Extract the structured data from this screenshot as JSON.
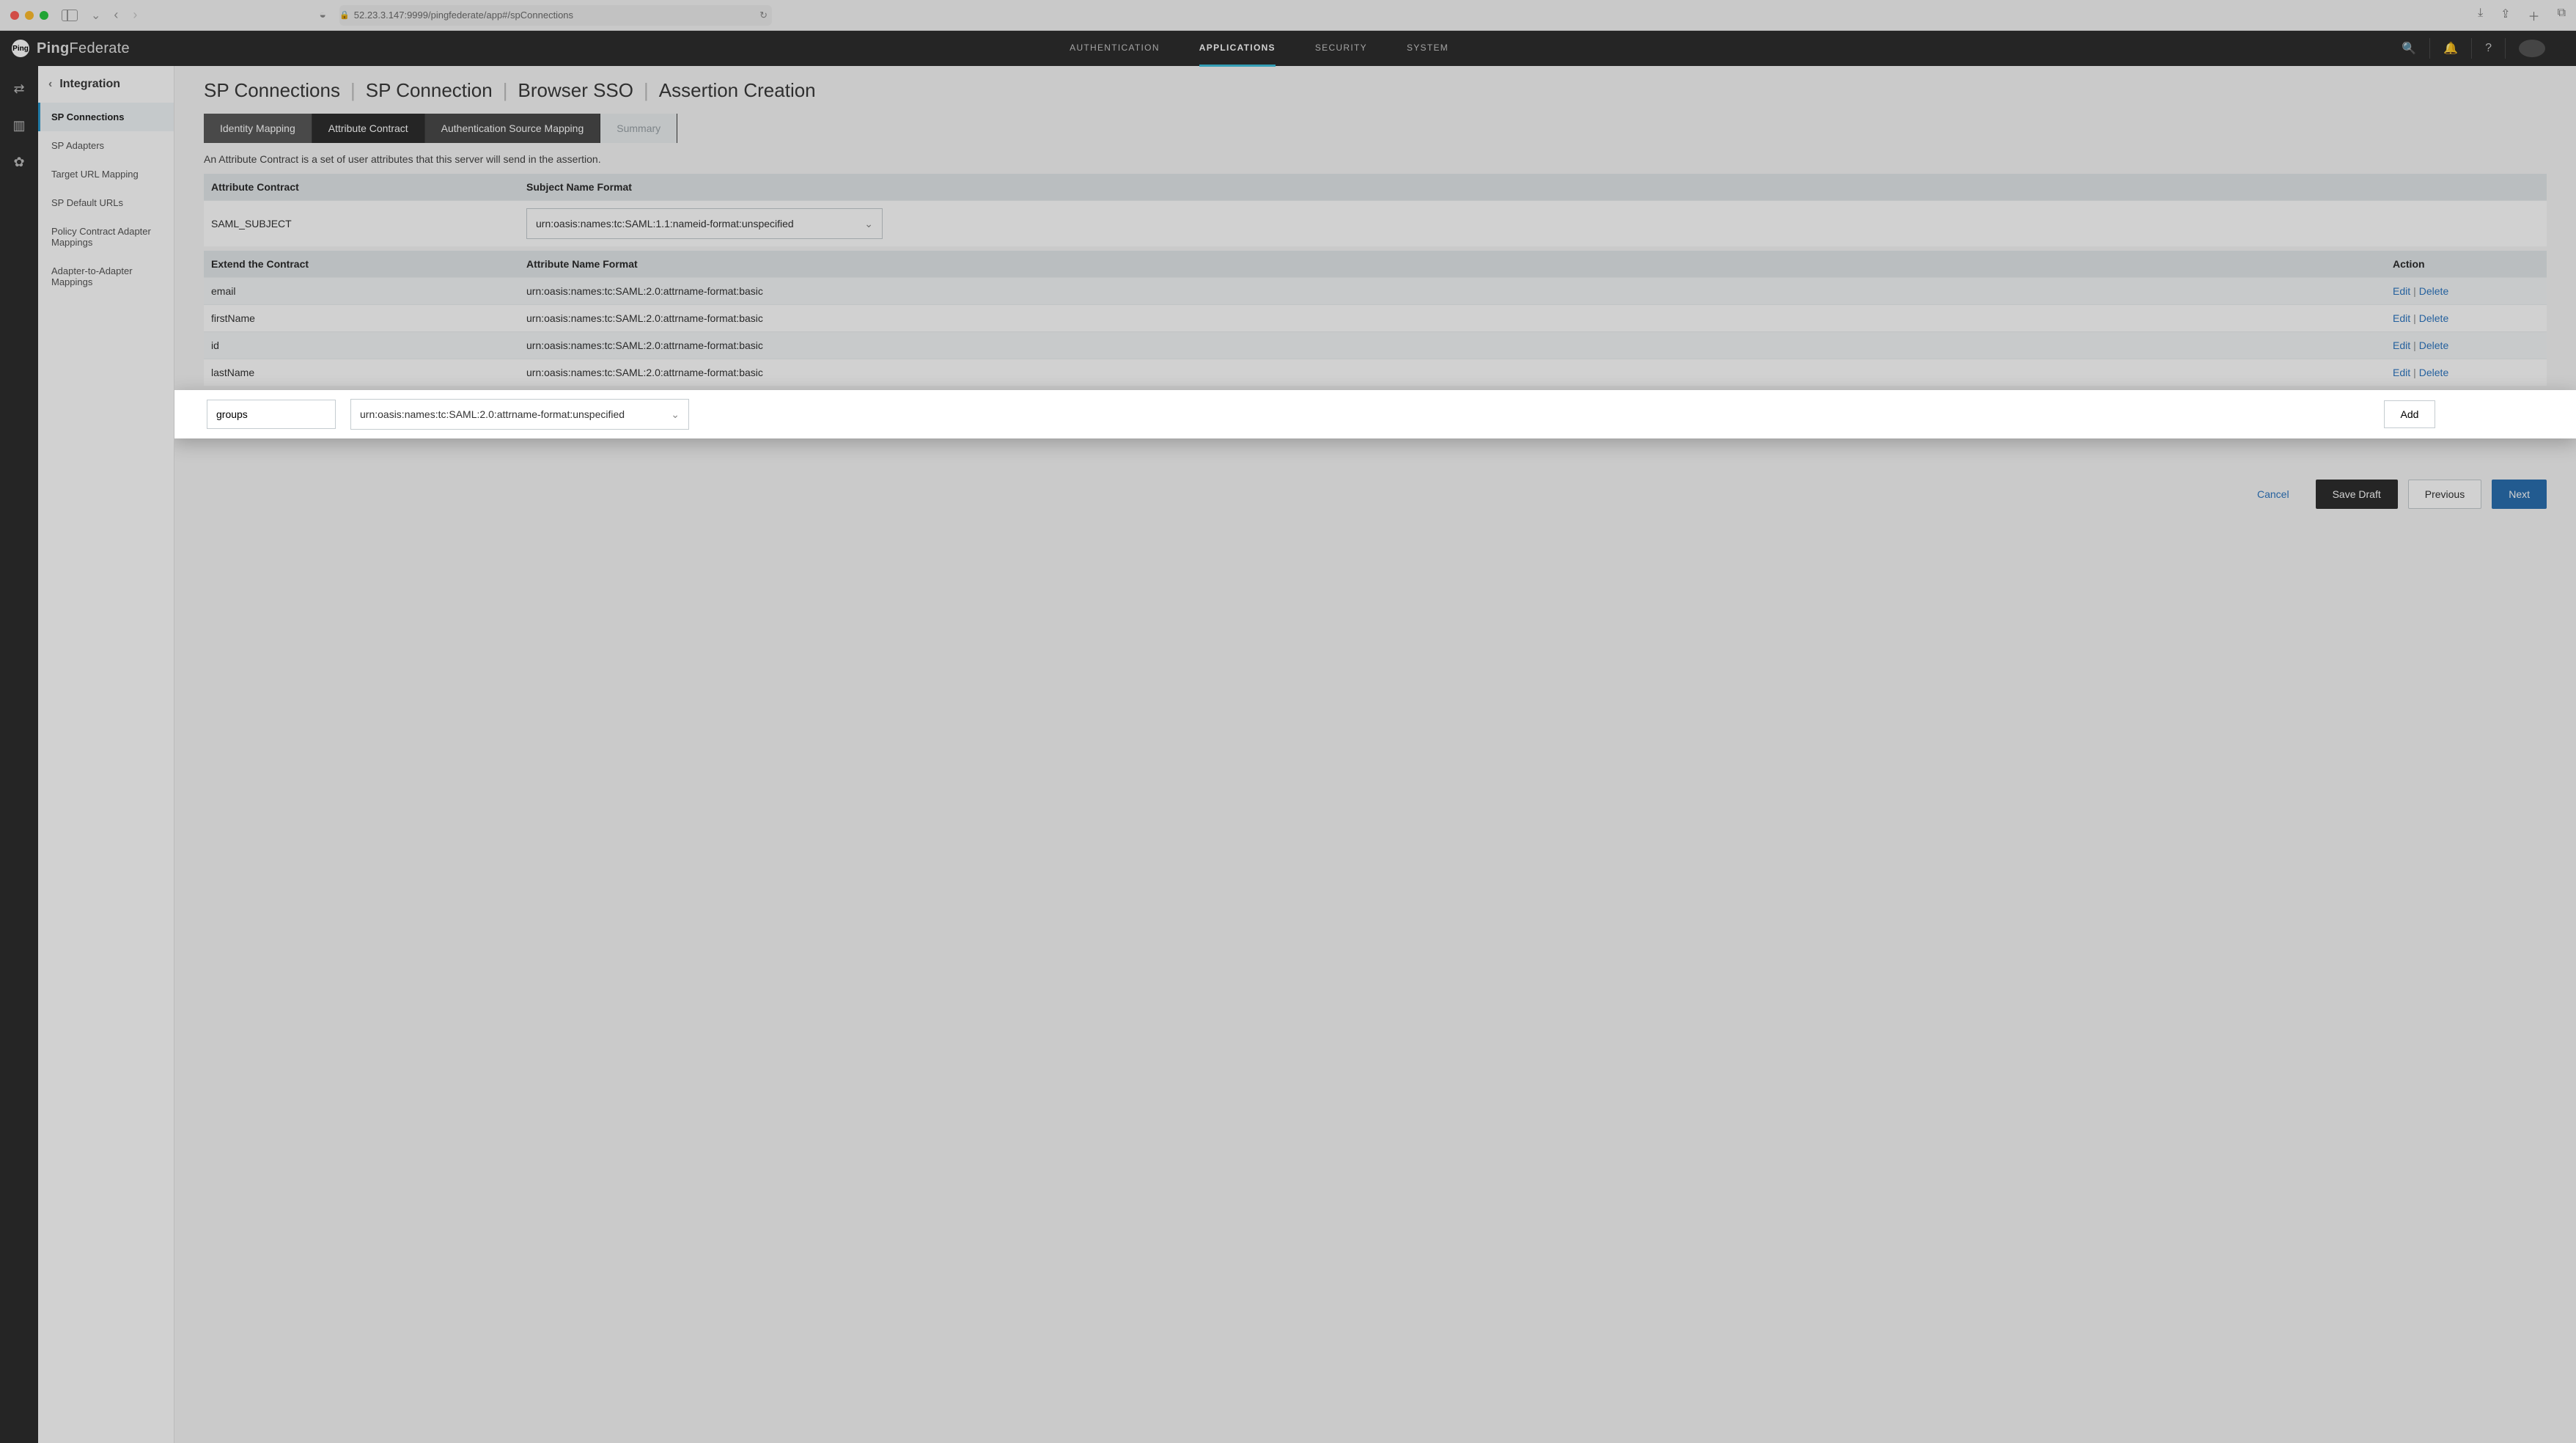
{
  "browser": {
    "url": "52.23.3.147:9999/pingfederate/app#/spConnections"
  },
  "brand": {
    "prefix": "Ping",
    "suffix": "Federate",
    "logo_text": "Ping"
  },
  "top_nav": {
    "items": [
      "AUTHENTICATION",
      "APPLICATIONS",
      "SECURITY",
      "SYSTEM"
    ],
    "active_index": 1
  },
  "sidebar": {
    "header": "Integration",
    "items": [
      {
        "label": "SP Connections",
        "active": true
      },
      {
        "label": "SP Adapters"
      },
      {
        "label": "Target URL Mapping"
      },
      {
        "label": "SP Default URLs"
      },
      {
        "label": "Policy Contract Adapter Mappings"
      },
      {
        "label": "Adapter-to-Adapter Mappings"
      }
    ]
  },
  "breadcrumbs": [
    "SP Connections",
    "SP Connection",
    "Browser SSO",
    "Assertion Creation"
  ],
  "tabs": [
    {
      "label": "Identity Mapping",
      "kind": "prev"
    },
    {
      "label": "Attribute Contract",
      "kind": "active"
    },
    {
      "label": "Authentication Source Mapping",
      "kind": "next"
    },
    {
      "label": "Summary",
      "kind": "disabled"
    }
  ],
  "help_text": "An Attribute Contract is a set of user attributes that this server will send in the assertion.",
  "contract_table": {
    "headers": {
      "attr": "Attribute Contract",
      "fmt": "Subject Name Format"
    },
    "rows": [
      {
        "attr": "SAML_SUBJECT",
        "fmt": "urn:oasis:names:tc:SAML:1.1:nameid-format:unspecified"
      }
    ]
  },
  "extend_table": {
    "headers": {
      "attr": "Extend the Contract",
      "fmt": "Attribute Name Format",
      "act": "Action"
    },
    "rows": [
      {
        "attr": "email",
        "fmt": "urn:oasis:names:tc:SAML:2.0:attrname-format:basic"
      },
      {
        "attr": "firstName",
        "fmt": "urn:oasis:names:tc:SAML:2.0:attrname-format:basic"
      },
      {
        "attr": "id",
        "fmt": "urn:oasis:names:tc:SAML:2.0:attrname-format:basic"
      },
      {
        "attr": "lastName",
        "fmt": "urn:oasis:names:tc:SAML:2.0:attrname-format:basic"
      }
    ],
    "action_edit": "Edit",
    "action_delete": "Delete"
  },
  "add_row": {
    "input_value": "groups",
    "format_value": "urn:oasis:names:tc:SAML:2.0:attrname-format:unspecified",
    "button": "Add"
  },
  "footer": {
    "cancel": "Cancel",
    "save_draft": "Save Draft",
    "previous": "Previous",
    "next": "Next"
  }
}
